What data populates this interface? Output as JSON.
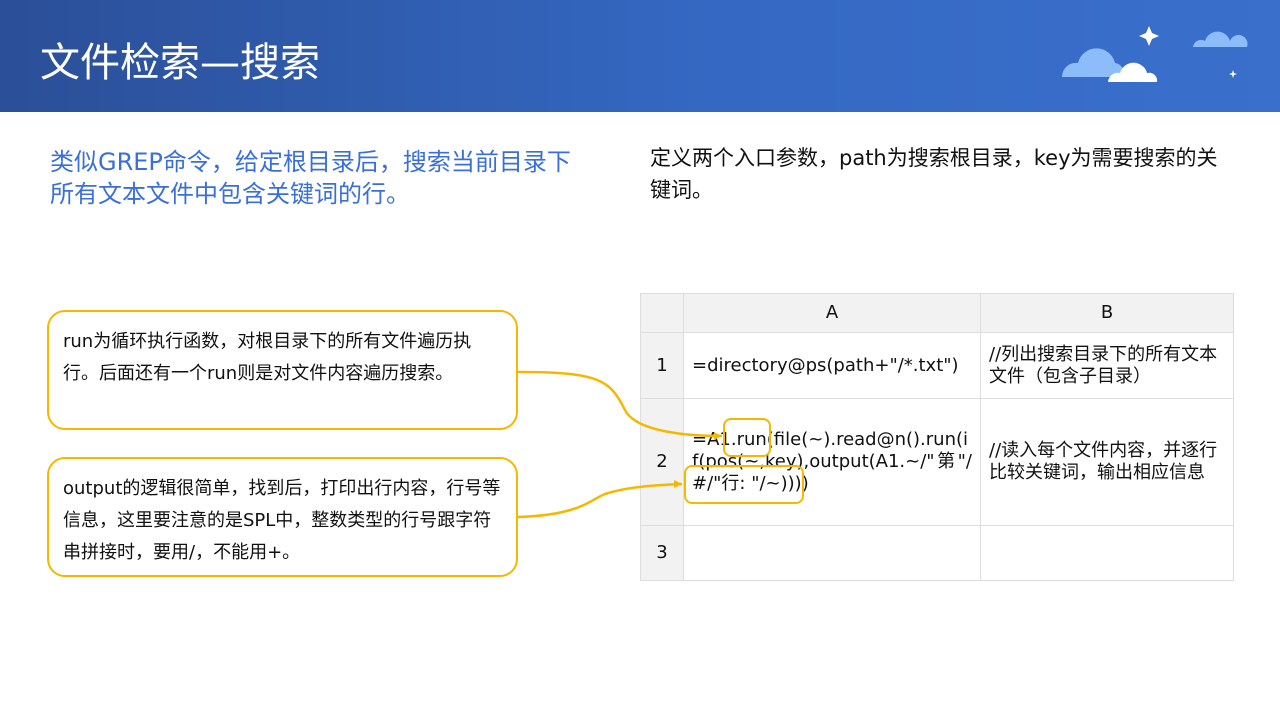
{
  "title": "文件检索—搜索",
  "desc_left": "类似GREP命令，给定根目录后，搜索当前目录下所有文本文件中包含关键词的行。",
  "desc_right": "定义两个入口参数，path为搜索根目录，key为需要搜索的关键词。",
  "callouts": [
    "run为循环执行函数，对根目录下的所有文件遍历执行。后面还有一个run则是对文件内容遍历搜索。",
    "output的逻辑很简单，找到后，打印出行内容，行号等信息，这里要注意的是SPL中，整数类型的行号跟字符串拼接时，要用/，不能用+。"
  ],
  "table": {
    "columns": [
      "A",
      "B"
    ],
    "rows": [
      {
        "n": "1",
        "a": "=directory@ps(path+\"/*.txt\")",
        "b": "//列出搜索目录下的所有文本文件（包含子目录）"
      },
      {
        "n": "2",
        "a": "=A1.run(file(~).read@n().run(if(pos(~,key),output(A1.~/\"第\"/#/\"行: \"/~))))",
        "b": "//读入每个文件内容，并逐行比较关键词，输出相应信息"
      },
      {
        "n": "3",
        "a": "",
        "b": ""
      }
    ]
  },
  "colors": {
    "accent": "#3a6fd8",
    "callout_border": "#f5b800"
  }
}
